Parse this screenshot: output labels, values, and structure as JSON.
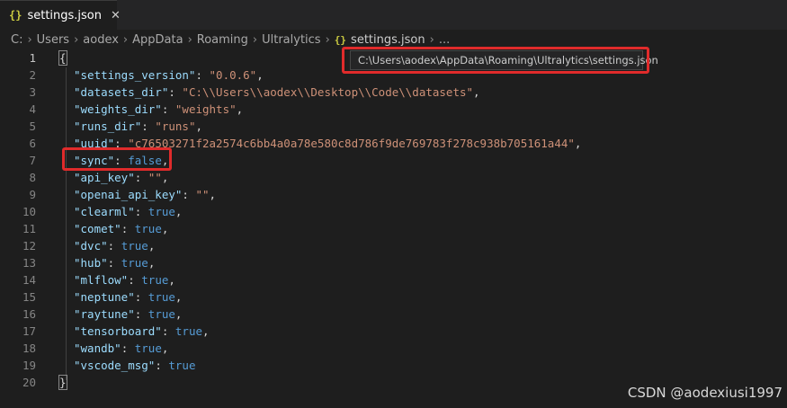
{
  "tab": {
    "icon": "{}",
    "label": "settings.json",
    "close": "✕"
  },
  "breadcrumb": {
    "items": [
      "C:",
      "Users",
      "aodex",
      "AppData",
      "Roaming",
      "Ultralytics"
    ],
    "file_icon": "{}",
    "file": "settings.json",
    "more": "..."
  },
  "tooltip": "C:\\Users\\aodex\\AppData\\Roaming\\Ultralytics\\settings.json",
  "lines": {
    "l1": {
      "num": "1",
      "open": "{"
    },
    "l2": {
      "num": "2",
      "key": "\"settings_version\"",
      "value": "\"0.0.6\""
    },
    "l3": {
      "num": "3",
      "key": "\"datasets_dir\"",
      "value": "\"C:\\\\Users\\\\aodex\\\\Desktop\\\\Code\\\\datasets\""
    },
    "l4": {
      "num": "4",
      "key": "\"weights_dir\"",
      "value": "\"weights\""
    },
    "l5": {
      "num": "5",
      "key": "\"runs_dir\"",
      "value": "\"runs\""
    },
    "l6": {
      "num": "6",
      "key": "\"uuid\"",
      "value": "\"c76503271f2a2574c6bb4a0a78e580c8d786f9de769783f278c938b705161a44\""
    },
    "l7": {
      "num": "7",
      "key": "\"sync\"",
      "value": "false"
    },
    "l8": {
      "num": "8",
      "key": "\"api_key\"",
      "value": "\"\""
    },
    "l9": {
      "num": "9",
      "key": "\"openai_api_key\"",
      "value": "\"\""
    },
    "l10": {
      "num": "10",
      "key": "\"clearml\"",
      "value": "true"
    },
    "l11": {
      "num": "11",
      "key": "\"comet\"",
      "value": "true"
    },
    "l12": {
      "num": "12",
      "key": "\"dvc\"",
      "value": "true"
    },
    "l13": {
      "num": "13",
      "key": "\"hub\"",
      "value": "true"
    },
    "l14": {
      "num": "14",
      "key": "\"mlflow\"",
      "value": "true"
    },
    "l15": {
      "num": "15",
      "key": "\"neptune\"",
      "value": "true"
    },
    "l16": {
      "num": "16",
      "key": "\"raytune\"",
      "value": "true"
    },
    "l17": {
      "num": "17",
      "key": "\"tensorboard\"",
      "value": "true"
    },
    "l18": {
      "num": "18",
      "key": "\"wandb\"",
      "value": "true"
    },
    "l19": {
      "num": "19",
      "key": "\"vscode_msg\"",
      "value": "true"
    },
    "l20": {
      "num": "20",
      "close": "}"
    }
  },
  "watermark": "CSDN @aodexiusi1997",
  "colors": {
    "background": "#1e1e1e",
    "json_key": "#9cdcfe",
    "json_string": "#ce9178",
    "json_boolean": "#569cd6",
    "highlight_box": "#e02b2b"
  }
}
